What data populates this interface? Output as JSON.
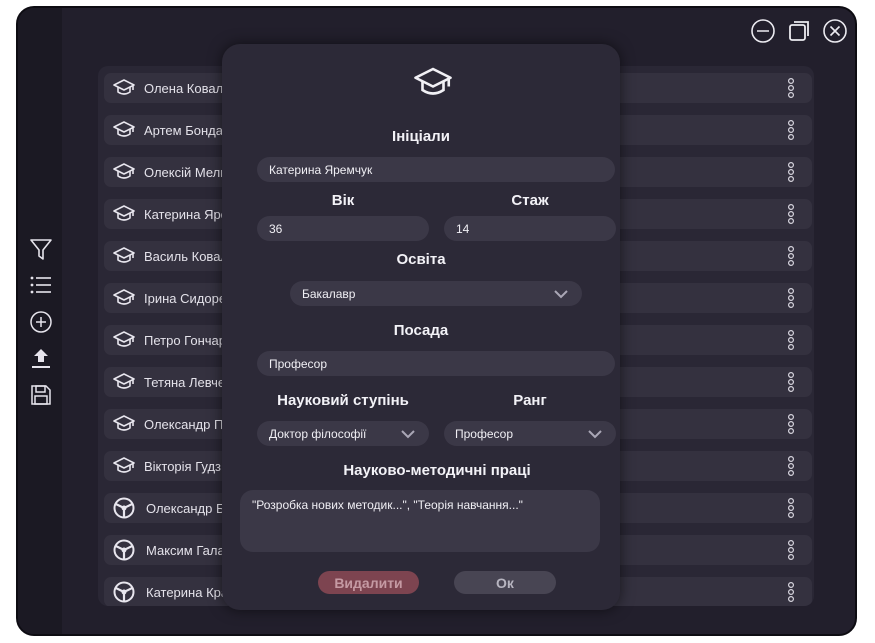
{
  "colors": {
    "window_bg": "#221f2c",
    "panel_bg": "#2a2735",
    "row_bg": "#34313f",
    "modal_bg": "#2c2937",
    "field_bg": "#3b3847",
    "delete_btn": "#7d4450",
    "ok_btn": "#484553",
    "text": "#e4e2ea"
  },
  "sidebar": {
    "icons": [
      "filter-icon",
      "list-icon",
      "add-circle-icon",
      "upload-icon",
      "save-icon"
    ]
  },
  "window_controls": {
    "icons": [
      "minimize-icon",
      "maximize-icon",
      "close-icon"
    ]
  },
  "list": {
    "items": [
      {
        "name": "Олена Ковален",
        "icon": "graduation-cap-icon"
      },
      {
        "name": "Артем Бондаре",
        "icon": "graduation-cap-icon"
      },
      {
        "name": "Олексій Мельн",
        "icon": "graduation-cap-icon"
      },
      {
        "name": "Катерина Ярем",
        "icon": "graduation-cap-icon"
      },
      {
        "name": "Василь Коваль",
        "icon": "graduation-cap-icon"
      },
      {
        "name": "Ірина Сидорен",
        "icon": "graduation-cap-icon"
      },
      {
        "name": "Петро Гончар",
        "icon": "graduation-cap-icon"
      },
      {
        "name": "Тетяна Левчен",
        "icon": "graduation-cap-icon"
      },
      {
        "name": "Олександр Пет",
        "icon": "graduation-cap-icon"
      },
      {
        "name": "Вікторія Гудз",
        "icon": "graduation-cap-icon"
      },
      {
        "name": "Олександр Бон",
        "icon": "steering-wheel-icon"
      },
      {
        "name": "Максим Галай",
        "icon": "steering-wheel-icon"
      },
      {
        "name": "Катерина Крав",
        "icon": "steering-wheel-icon"
      }
    ]
  },
  "modal": {
    "icon": "graduation-cap-icon",
    "initials_label": "Ініціали",
    "initials_value": "Катерина Яремчук",
    "age_label": "Вік",
    "age_value": "36",
    "experience_label": "Стаж",
    "experience_value": "14",
    "education_label": "Освіта",
    "education_value": "Бакалавр",
    "position_label": "Посада",
    "position_value": "Професор",
    "degree_label": "Науковий ступінь",
    "degree_value": "Доктор філософії",
    "rank_label": "Ранг",
    "rank_value": "Професор",
    "works_label": "Науково-методичні праці",
    "works_value": "\"Розробка нових методик...\", \"Теорія навчання...\"",
    "delete_label": "Видалити",
    "ok_label": "Ок"
  }
}
